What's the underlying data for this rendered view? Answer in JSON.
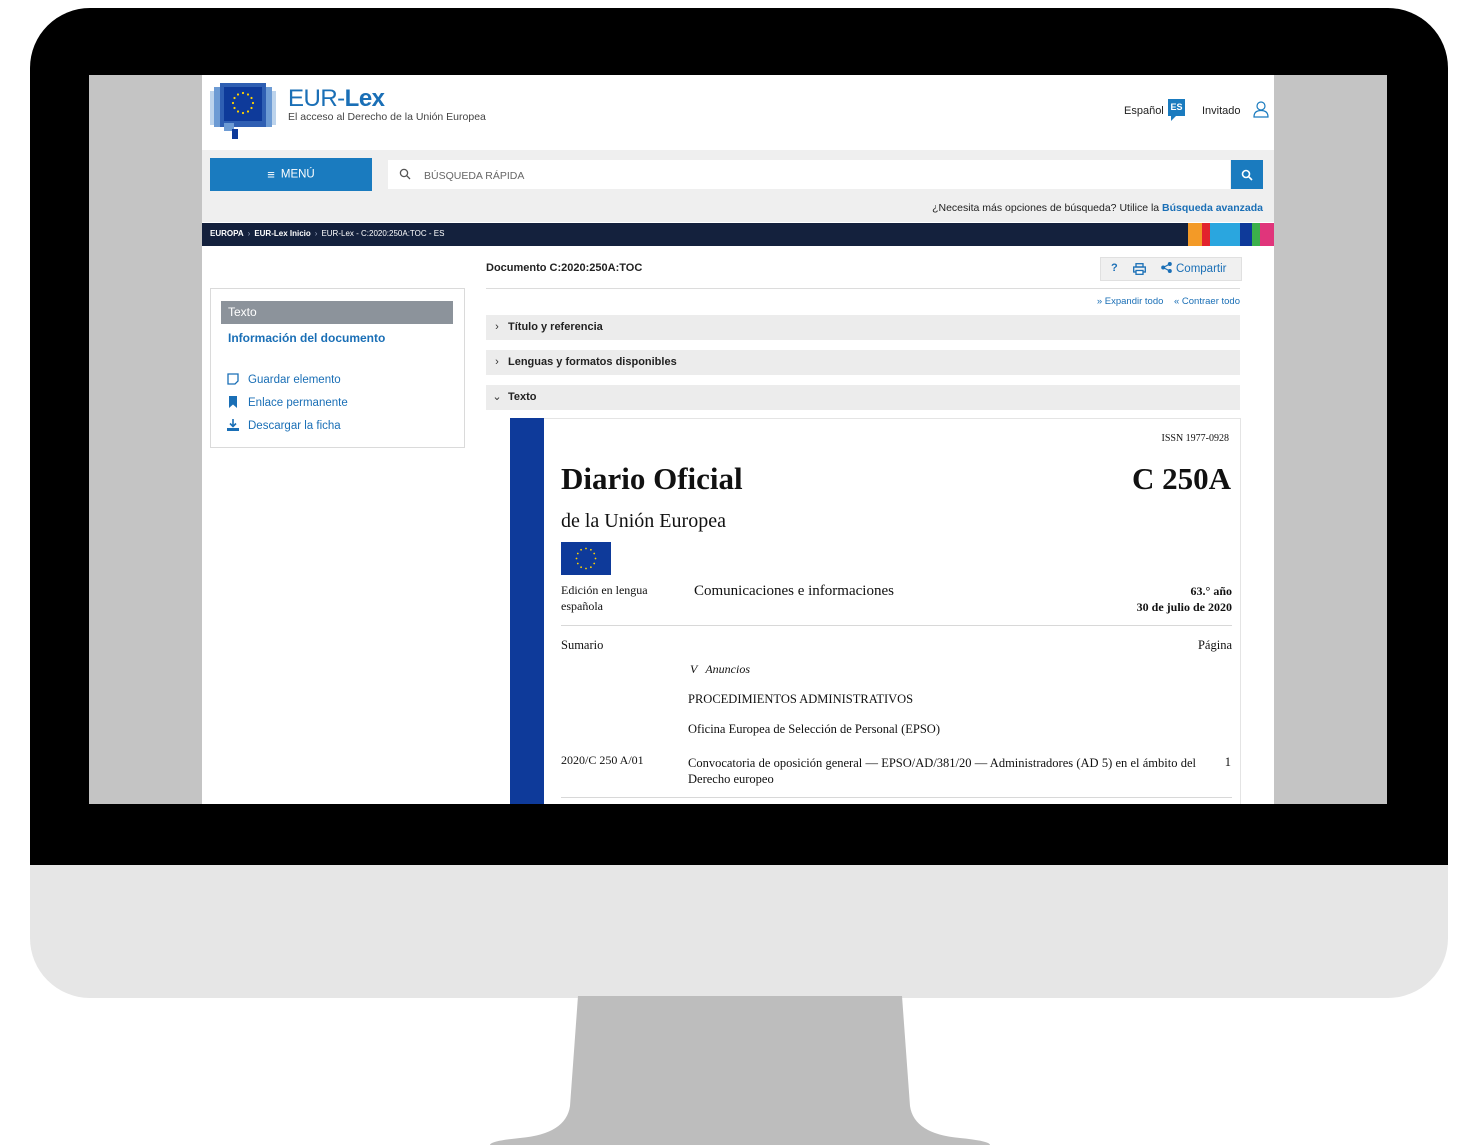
{
  "header": {
    "logo_prefix": "EUR-",
    "logo_bold": "Lex",
    "subtitle": "El acceso al Derecho de la Unión Europea",
    "language_label": "Español",
    "language_code": "ES",
    "user_label": "Invitado"
  },
  "search": {
    "menu_label": "MENÚ",
    "placeholder": "BÚSQUEDA RÁPIDA",
    "advanced_prefix": "¿Necesita más opciones de búsqueda? Utilice la ",
    "advanced_link": "Búsqueda avanzada"
  },
  "breadcrumb": {
    "items": [
      "EUROPA",
      "EUR-Lex Inicio",
      "EUR-Lex - C:2020:250A:TOC - ES"
    ]
  },
  "sidebar": {
    "heading": "Texto",
    "info_link": "Información del documento",
    "actions": [
      "Guardar elemento",
      "Enlace permanente",
      "Descargar la ficha"
    ]
  },
  "main": {
    "document_id": "Documento C:2020:250A:TOC",
    "help_label": "?",
    "share_label": "Compartir",
    "expand_all": "Expandir todo",
    "collapse_all": "Contraer todo",
    "sections": [
      "Título y referencia",
      "Lenguas y formatos disponibles",
      "Texto"
    ]
  },
  "journal": {
    "issn": "ISSN 1977-0928",
    "title": "Diario Oficial",
    "number": "C 250A",
    "subtitle": "de la Unión Europea",
    "edition_line1": "Edición en lengua",
    "edition_line2": "española",
    "communications": "Comunicaciones e informaciones",
    "year": "63.° año",
    "date": "30 de julio de 2020",
    "summary_label": "Sumario",
    "page_label": "Página",
    "section_number": "V",
    "section_title": "Anuncios",
    "procedures": "PROCEDIMIENTOS ADMINISTRATIVOS",
    "office": "Oficina Europea de Selección de Personal (EPSO)",
    "entry_ref": "2020/C 250 A/01",
    "entry_text": "Convocatoria de oposición general — EPSO/AD/381/20 — Administradores (AD 5) en el ámbito del Derecho europeo",
    "entry_page": "1"
  },
  "colors": {
    "brand_blue": "#1a7bbf",
    "breadcrumb_bg": "#14213d",
    "journal_blue": "#0e3a9a",
    "bezel": "#000000",
    "chin": "#e6e6e6",
    "stand": "#bdbdbd"
  }
}
